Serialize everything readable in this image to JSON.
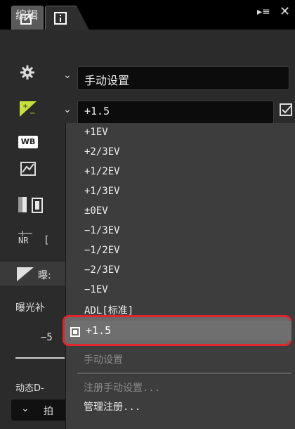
{
  "tabs": [
    {
      "name": "edit-tab"
    },
    {
      "name": "info-tab"
    }
  ],
  "header": {
    "title": "编辑",
    "menu_icon": "▸≡",
    "close_icon": "✕"
  },
  "side": {
    "row1_value": "手动设置",
    "row2_value": "+1.5",
    "exposure_label": "曝:",
    "exposure_comp_label": "曝光补",
    "slider_min": "−5",
    "dynamic_label": "动态D-",
    "bottom_label": "拍"
  },
  "dropdown": {
    "options": [
      "+1EV",
      "+2/3EV",
      "+1/2EV",
      "+1/3EV",
      "±0EV",
      "−1/3EV",
      "−1/2EV",
      "−2/3EV",
      "−1EV",
      "ADL[标准]"
    ],
    "selected": "+1.5",
    "manual": "手动设置",
    "register": "注册手动设置...",
    "manage": "管理注册..."
  },
  "colors": {
    "highlight": "#e0262b",
    "accent_green": "#c7e13a"
  }
}
